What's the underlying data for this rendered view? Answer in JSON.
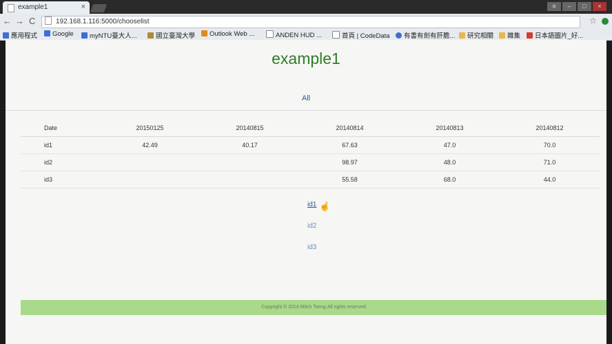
{
  "browser": {
    "tab_title": "example1",
    "tab_close": "×",
    "address": "192.168.1.116:5000/chooselist",
    "bookmarks": [
      {
        "label": "應用程式",
        "color": "#3b6fd4"
      },
      {
        "label": "Google",
        "color": "#3b6fd4"
      },
      {
        "label": "myNTU臺大人...",
        "color": "#3b6fd4"
      },
      {
        "label": "國立臺灣大學",
        "color": "#b08a3a"
      },
      {
        "label": "Outlook Web ...",
        "color": "#e08a1a"
      },
      {
        "label": "ANDEN HUD ...",
        "color": "#ffffff"
      },
      {
        "label": "首頁 | CodeData",
        "color": "#ffffff"
      },
      {
        "label": "有書有劍有肝膽...",
        "color": "#3b6fd4"
      },
      {
        "label": "研究相關",
        "color": "#e8b84a"
      },
      {
        "label": "雜集",
        "color": "#e8b84a"
      },
      {
        "label": "日本語圖片_好...",
        "color": "#d43b2a"
      }
    ]
  },
  "page": {
    "brand": "example1",
    "all_link": "All",
    "table": {
      "headers": [
        "Date",
        "20150125",
        "20140815",
        "20140814",
        "20140813",
        "20140812"
      ],
      "rows": [
        [
          "id1",
          "42.49",
          "40.17",
          "67.63",
          "47.0",
          "70.0"
        ],
        [
          "id2",
          "",
          "",
          "98.97",
          "48.0",
          "71.0"
        ],
        [
          "id3",
          "",
          "",
          "55.58",
          "68.0",
          "44.0"
        ]
      ]
    },
    "links": [
      "id1",
      "id2",
      "id3"
    ],
    "footer": "Copyright © 2014 Mitch Tseng.All rights reserved"
  }
}
